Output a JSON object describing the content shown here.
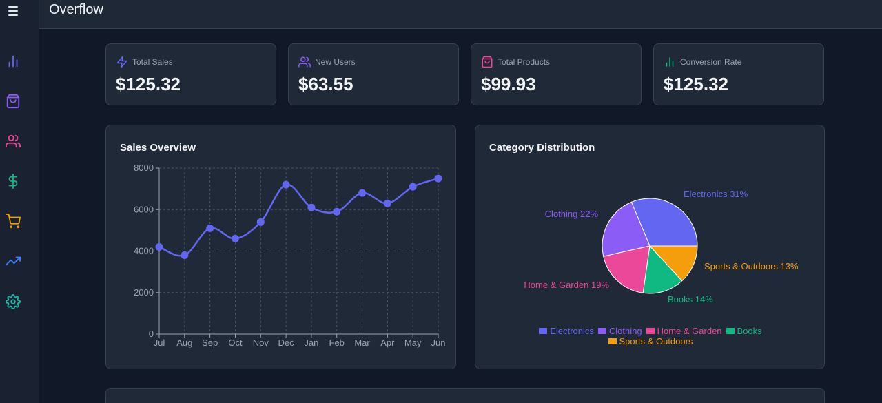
{
  "app": {
    "title": "Overflow"
  },
  "sidebar": {
    "items": [
      {
        "name": "analytics",
        "icon": "bar-chart-icon",
        "color": "#6366f1"
      },
      {
        "name": "products",
        "icon": "shopping-bag-icon",
        "color": "#8b5cf6"
      },
      {
        "name": "users",
        "icon": "users-icon",
        "color": "#ec4899"
      },
      {
        "name": "sales",
        "icon": "dollar-sign-icon",
        "color": "#10b981"
      },
      {
        "name": "orders",
        "icon": "shopping-cart-icon",
        "color": "#f59e0b"
      },
      {
        "name": "trends",
        "icon": "trending-up-icon",
        "color": "#3b82f6"
      },
      {
        "name": "settings",
        "icon": "settings-icon",
        "color": "#14b8a6"
      }
    ]
  },
  "stats": [
    {
      "label": "Total Sales",
      "value": "$125.32",
      "icon": "zap-icon",
      "color": "#6366f1"
    },
    {
      "label": "New Users",
      "value": "$63.55",
      "icon": "users-icon",
      "color": "#8b5cf6"
    },
    {
      "label": "Total Products",
      "value": "$99.93",
      "icon": "shopping-bag-icon",
      "color": "#ec4899"
    },
    {
      "label": "Conversion Rate",
      "value": "$125.32",
      "icon": "bar-chart-icon",
      "color": "#10b981"
    }
  ],
  "sales_overview": {
    "title": "Sales Overview"
  },
  "category_distribution": {
    "title": "Category Distribution"
  },
  "chart_data": [
    {
      "type": "line",
      "title": "Sales Overview",
      "categories": [
        "Jul",
        "Aug",
        "Sep",
        "Oct",
        "Nov",
        "Dec",
        "Jan",
        "Feb",
        "Mar",
        "Apr",
        "May",
        "Jun"
      ],
      "values": [
        4200,
        3800,
        5100,
        4600,
        5400,
        7200,
        6100,
        5900,
        6800,
        6300,
        7100,
        7500
      ],
      "ylim": [
        0,
        8000
      ],
      "yticks": [
        0,
        2000,
        4000,
        6000,
        8000
      ],
      "color": "#6366f1",
      "grid": true
    },
    {
      "type": "pie",
      "title": "Category Distribution",
      "slices": [
        {
          "name": "Electronics",
          "value": 31,
          "label": "Electronics 31%",
          "color": "#6366f1"
        },
        {
          "name": "Clothing",
          "value": 22,
          "label": "Clothing 22%",
          "color": "#8b5cf6"
        },
        {
          "name": "Home & Garden",
          "value": 19,
          "label": "Home & Garden 19%",
          "color": "#ec4899"
        },
        {
          "name": "Books",
          "value": 14,
          "label": "Books 14%",
          "color": "#10b981"
        },
        {
          "name": "Sports & Outdoors",
          "value": 13,
          "label": "Sports & Outdoors 13%",
          "color": "#f59e0b"
        }
      ],
      "legend": "bottom"
    }
  ]
}
